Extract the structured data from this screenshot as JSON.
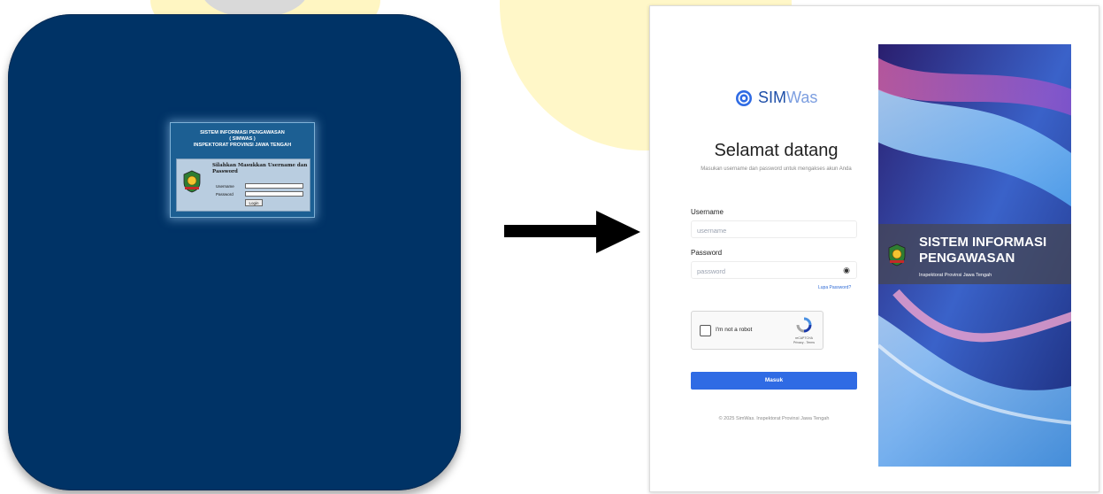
{
  "old_ui": {
    "title_lines": [
      "SISTEM INFORMASI PENGAWASAN",
      "( SIMWAS )",
      "INSPEKTORAT PROVINSI JAWA TENGAH"
    ],
    "prompt": "Silahkan Masukkan Username dan Password",
    "username_label": "Username",
    "password_label": "Password",
    "login_button": "Login"
  },
  "new_ui": {
    "brand_main": "SIM",
    "brand_light": "Was",
    "welcome": "Selamat datang",
    "subtitle": "Masukan username dan password untuk mengakses akun Anda",
    "username_label": "Username",
    "username_placeholder": "username",
    "password_label": "Password",
    "password_placeholder": "password",
    "forgot_link": "Lupa Password?",
    "captcha_text": "I'm not a robot",
    "captcha_brand": "reCAPTCHA",
    "captcha_links": "Privacy - Terms",
    "submit_button": "Masuk",
    "footer": "© 2025 SimWas. Inspektorat Provinsi Jawa Tengah",
    "banner_title_1": "SISTEM INFORMASI",
    "banner_title_2": "PENGAWASAN",
    "banner_subtitle": "Inspektorat Provinsi Jawa Tengah"
  },
  "colors": {
    "old_background": "#003366",
    "old_panel": "#1c5f93",
    "primary_button": "#2f6be4",
    "brand": "#1d4ea8"
  }
}
